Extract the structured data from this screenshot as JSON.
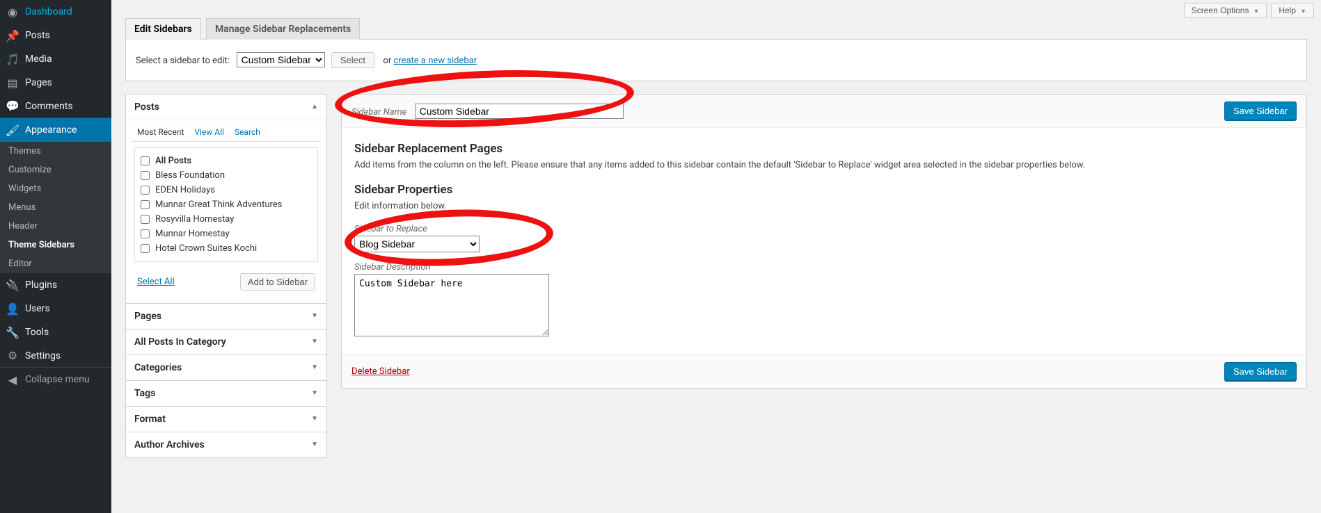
{
  "topbar": {
    "screen_options": "Screen Options",
    "help": "Help"
  },
  "adminmenu": {
    "dashboard": "Dashboard",
    "posts": "Posts",
    "media": "Media",
    "pages": "Pages",
    "comments": "Comments",
    "appearance": "Appearance",
    "appearance_sub": {
      "themes": "Themes",
      "customize": "Customize",
      "widgets": "Widgets",
      "menus": "Menus",
      "header": "Header",
      "theme_sidebars": "Theme Sidebars",
      "editor": "Editor"
    },
    "plugins": "Plugins",
    "users": "Users",
    "tools": "Tools",
    "settings": "Settings",
    "collapse": "Collapse menu"
  },
  "tabs": {
    "edit": "Edit Sidebars",
    "manage": "Manage Sidebar Replacements"
  },
  "selectbar": {
    "label": "Select a sidebar to edit:",
    "value": "Custom Sidebar",
    "select_btn": "Select",
    "or": "or",
    "create_link": "create a new sidebar"
  },
  "postsbox": {
    "title": "Posts",
    "tab_recent": "Most Recent",
    "tab_viewall": "View All",
    "tab_search": "Search",
    "all": "All Posts",
    "items": [
      "Bless Foundation",
      "EDEN Holidays",
      "Munnar Great Think Adventures",
      "Rosyvilla Homestay",
      "Munnar Homestay",
      "Hotel Crown Suites Kochi"
    ],
    "select_all": "Select All",
    "add_btn": "Add to Sidebar"
  },
  "accordions": {
    "pages": "Pages",
    "allpostscat": "All Posts In Category",
    "categories": "Categories",
    "tags": "Tags",
    "format": "Format",
    "author": "Author Archives"
  },
  "settings": {
    "sidebar_name_label": "Sidebar Name",
    "sidebar_name_value": "Custom Sidebar",
    "save_btn": "Save Sidebar",
    "replacement_title": "Sidebar Replacement Pages",
    "replacement_desc": "Add items from the column on the left. Please ensure that any items added to this sidebar contain the default 'Sidebar to Replace' widget area selected in the sidebar properties below.",
    "properties_title": "Sidebar Properties",
    "properties_desc": "Edit information below.",
    "replace_label": "Sidebar to Replace",
    "replace_value": "Blog Sidebar",
    "desc_label": "Sidebar Description",
    "desc_value": "Custom Sidebar here",
    "delete": "Delete Sidebar"
  }
}
